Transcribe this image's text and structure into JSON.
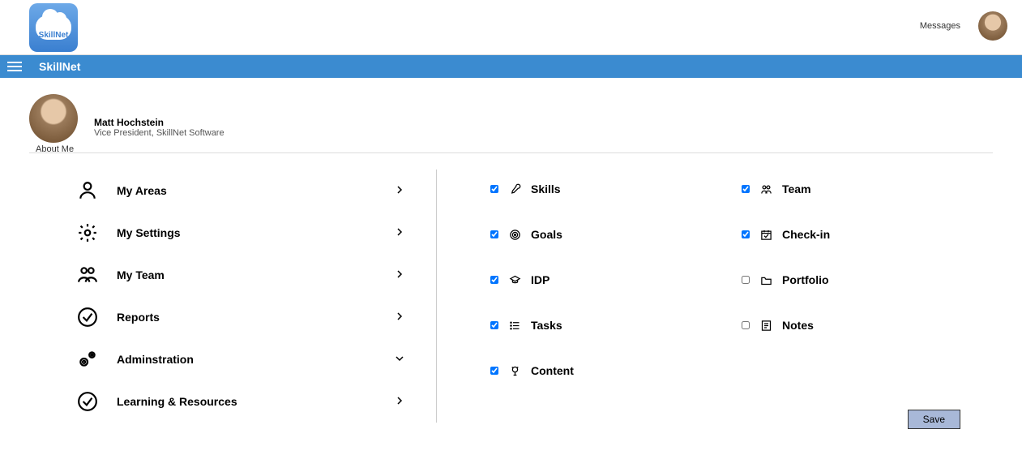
{
  "header": {
    "logo_text": "SkillNet",
    "messages_link": "Messages",
    "app_title": "SkillNet"
  },
  "user": {
    "name": "Matt Hochstein",
    "title": "Vice President, SkillNet Software",
    "about_me_label": "About Me"
  },
  "nav": {
    "items": [
      {
        "label": "My Areas",
        "expanded": false
      },
      {
        "label": "My Settings",
        "expanded": false
      },
      {
        "label": "My Team",
        "expanded": false
      },
      {
        "label": "Reports",
        "expanded": false
      },
      {
        "label": "Adminstration",
        "expanded": true
      },
      {
        "label": "Learning & Resources",
        "expanded": false
      }
    ]
  },
  "options": {
    "left": [
      {
        "label": "Skills",
        "checked": true
      },
      {
        "label": "Goals",
        "checked": true
      },
      {
        "label": "IDP",
        "checked": true
      },
      {
        "label": "Tasks",
        "checked": true
      },
      {
        "label": "Content",
        "checked": true
      }
    ],
    "right": [
      {
        "label": "Team",
        "checked": true
      },
      {
        "label": "Check-in",
        "checked": true
      },
      {
        "label": "Portfolio",
        "checked": false
      },
      {
        "label": "Notes",
        "checked": false
      }
    ]
  },
  "buttons": {
    "save": "Save"
  }
}
